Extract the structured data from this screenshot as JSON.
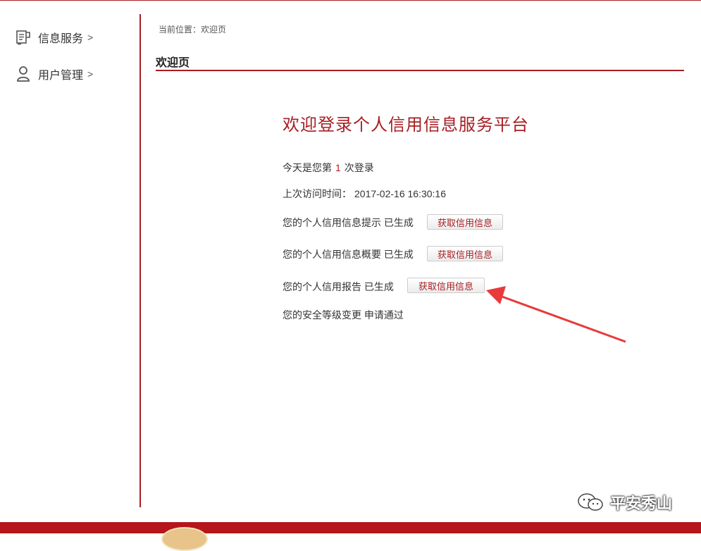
{
  "sidebar": {
    "items": [
      {
        "label": "信息服务",
        "arrow": ">",
        "icon": "document-icon"
      },
      {
        "label": "用户管理",
        "arrow": ">",
        "icon": "user-icon"
      }
    ]
  },
  "breadcrumb": "当前位置：欢迎页",
  "page_title": "欢迎页",
  "welcome": {
    "heading": "欢迎登录个人信用信息服务平台",
    "login_count_prefix": "今天是您第",
    "login_count": "1",
    "login_count_suffix": "次登录",
    "last_visit_label": "上次访问时间：",
    "last_visit_time": "2017-02-16 16:30:16",
    "rows": [
      {
        "text": "您的个人信用信息提示 已生成",
        "button": "获取信用信息"
      },
      {
        "text": "您的个人信用信息概要 已生成",
        "button": "获取信用信息"
      },
      {
        "text": "您的个人信用报告 已生成",
        "button": "获取信用信息"
      }
    ],
    "security_text": "您的安全等级变更 申请通过"
  },
  "watermark": {
    "text": "平安秀山",
    "icon": "wechat-icon"
  },
  "colors": {
    "accent": "#a71e22",
    "annotation": "#e83a3a",
    "footer": "#b5161c"
  }
}
